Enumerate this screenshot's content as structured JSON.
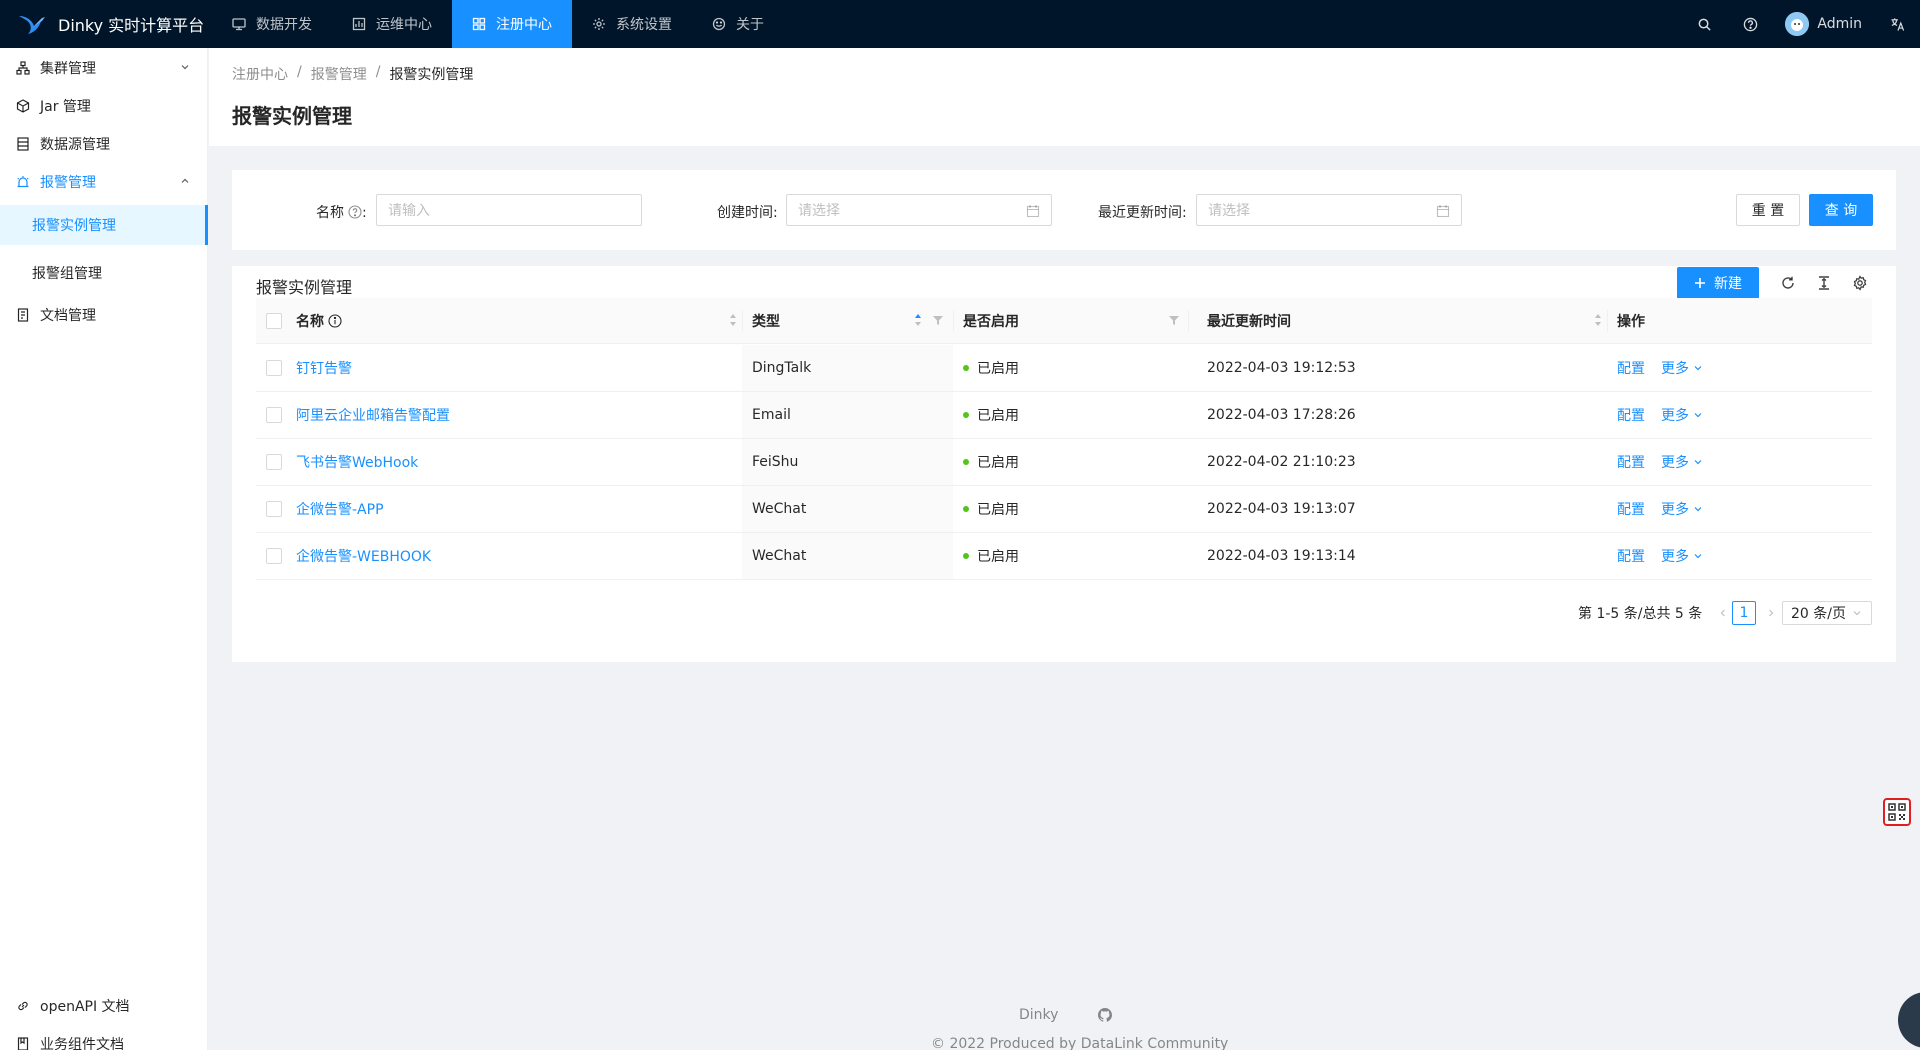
{
  "app": {
    "title": "Dinky 实时计算平台"
  },
  "topnav": {
    "items": [
      {
        "label": "数据开发",
        "icon": "monitor-icon",
        "active": false
      },
      {
        "label": "运维中心",
        "icon": "dashboard-icon",
        "active": false
      },
      {
        "label": "注册中心",
        "icon": "appstore-icon",
        "active": true
      },
      {
        "label": "系统设置",
        "icon": "gear-icon",
        "active": false
      },
      {
        "label": "关于",
        "icon": "smile-icon",
        "active": false
      }
    ],
    "user": "Admin"
  },
  "sidebar": {
    "items": [
      {
        "label": "集群管理",
        "icon": "cluster-icon"
      },
      {
        "label": "Jar 管理",
        "icon": "box-icon"
      },
      {
        "label": "数据源管理",
        "icon": "database-icon"
      },
      {
        "label": "报警管理",
        "icon": "alert-icon"
      },
      {
        "label": "文档管理",
        "icon": "doc-icon"
      }
    ],
    "sub_items": [
      {
        "label": "报警实例管理",
        "active": true
      },
      {
        "label": "报警组管理",
        "active": false
      }
    ],
    "bottom": [
      {
        "label": "openAPI 文档",
        "icon": "link-icon"
      },
      {
        "label": "业务组件文档",
        "icon": "book-icon"
      }
    ]
  },
  "breadcrumb": [
    "注册中心",
    "报警管理",
    "报警实例管理"
  ],
  "page_title": "报警实例管理",
  "search_form": {
    "name_label": "名称",
    "name_placeholder": "请输入",
    "created_label": "创建时间",
    "created_placeholder": "请选择",
    "updated_label": "最近更新时间",
    "updated_placeholder": "请选择",
    "reset_label": "重 置",
    "query_label": "查 询"
  },
  "table": {
    "title": "报警实例管理",
    "new_label": "新建",
    "columns": [
      "名称",
      "类型",
      "是否启用",
      "最近更新时间",
      "操作"
    ],
    "rows": [
      {
        "name": "钉钉告警",
        "type": "DingTalk",
        "status": "已启用",
        "updated": "2022-04-03 19:12:53"
      },
      {
        "name": "阿里云企业邮箱告警配置",
        "type": "Email",
        "status": "已启用",
        "updated": "2022-04-03 17:28:26"
      },
      {
        "name": "飞书告警WebHook",
        "type": "FeiShu",
        "status": "已启用",
        "updated": "2022-04-02 21:10:23"
      },
      {
        "name": "企微告警-APP",
        "type": "WeChat",
        "status": "已启用",
        "updated": "2022-04-03 19:13:07"
      },
      {
        "name": "企微告警-WEBHOOK",
        "type": "WeChat",
        "status": "已启用",
        "updated": "2022-04-03 19:13:14"
      }
    ],
    "action_config": "配置",
    "action_more": "更多"
  },
  "pagination": {
    "total_text": "第 1-5 条/总共 5 条",
    "current_page": "1",
    "page_size": "20 条/页"
  },
  "footer": {
    "brand": "Dinky",
    "copyright": "© 2022 Produced by DataLink Community"
  },
  "colors": {
    "nav_bg": "#001529",
    "primary": "#1890ff",
    "success": "#52c41a"
  }
}
